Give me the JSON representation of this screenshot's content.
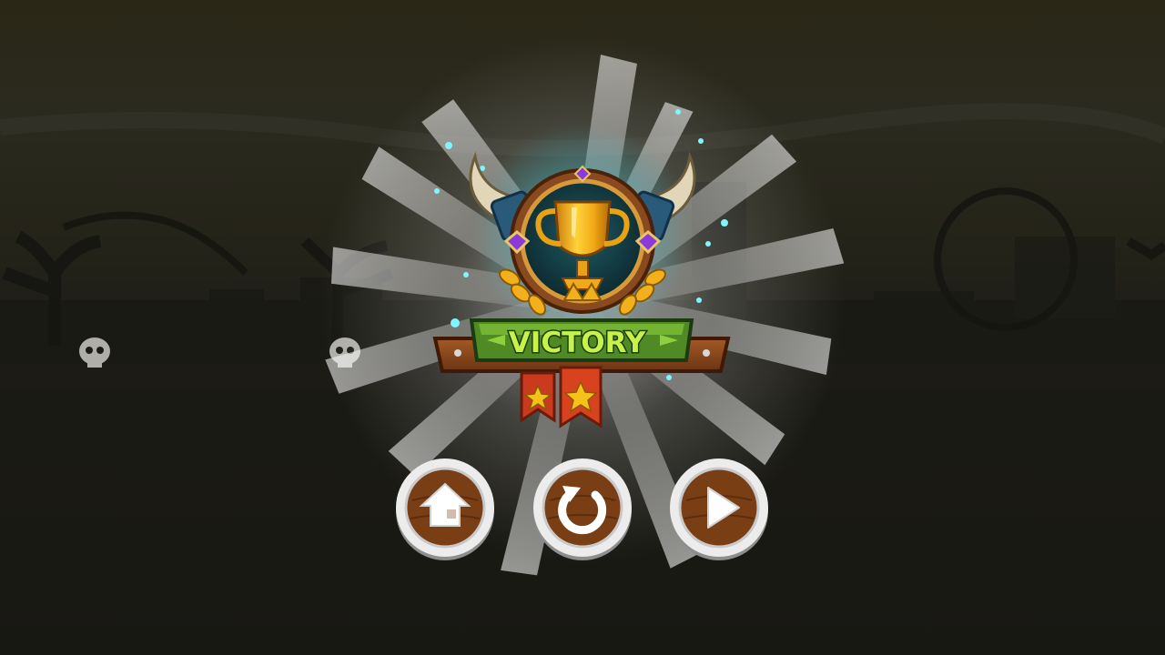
{
  "screen": {
    "title": "VICTORY",
    "stars_earned": 2,
    "stars_total": 2
  },
  "buttons": [
    {
      "id": "home",
      "icon": "home-icon"
    },
    {
      "id": "replay",
      "icon": "replay-icon"
    },
    {
      "id": "next",
      "icon": "play-icon"
    }
  ],
  "colors": {
    "title_fill": "#c7f24a",
    "title_outline": "#1d3b12",
    "wood": "#8b4a1f",
    "ribbon": "#c93a1e",
    "star": "#f5c21a",
    "trophy": "#f2a916",
    "button_ring": "#e9e9e9",
    "button_wood": "#7a3e15"
  }
}
